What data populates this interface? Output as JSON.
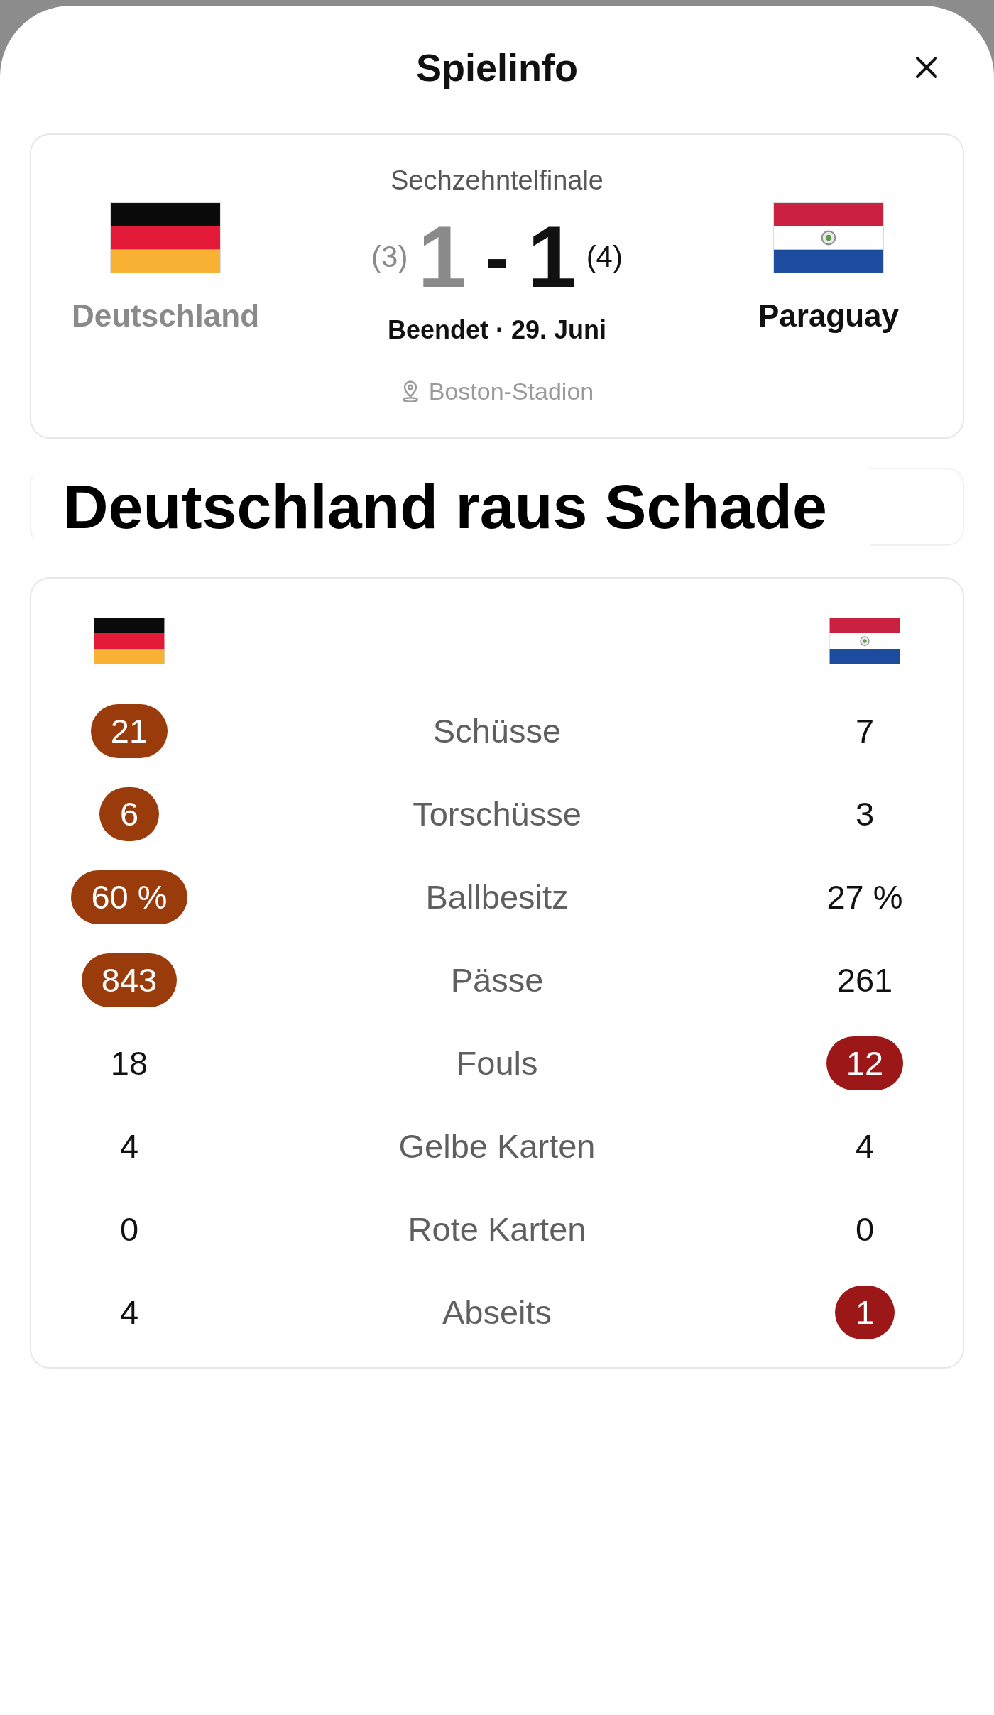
{
  "sheet": {
    "title": "Spielinfo"
  },
  "match": {
    "round": "Sechzehntelfinale",
    "teams": [
      {
        "name": "Deutschland",
        "goals": "1",
        "penalties": "(3)",
        "winner": false,
        "color": "#9a3b0b"
      },
      {
        "name": "Paraguay",
        "goals": "1",
        "penalties": "(4)",
        "winner": true,
        "color": "#9c1717"
      }
    ],
    "score_separator": "-",
    "status": "Beendet · 29. Juni",
    "venue": "Boston-Stadion"
  },
  "headline": "Deutschland raus Schade",
  "stats": {
    "rows": [
      {
        "label": "Schüsse",
        "home": {
          "value": "21",
          "highlighted": true
        },
        "away": {
          "value": "7",
          "highlighted": false
        }
      },
      {
        "label": "Torschüsse",
        "home": {
          "value": "6",
          "highlighted": true
        },
        "away": {
          "value": "3",
          "highlighted": false
        }
      },
      {
        "label": "Ballbesitz",
        "home": {
          "value": "60 %",
          "highlighted": true
        },
        "away": {
          "value": "27 %",
          "highlighted": false
        }
      },
      {
        "label": "Pässe",
        "home": {
          "value": "843",
          "highlighted": true
        },
        "away": {
          "value": "261",
          "highlighted": false
        }
      },
      {
        "label": "Fouls",
        "home": {
          "value": "18",
          "highlighted": false
        },
        "away": {
          "value": "12",
          "highlighted": true
        }
      },
      {
        "label": "Gelbe Karten",
        "home": {
          "value": "4",
          "highlighted": false
        },
        "away": {
          "value": "4",
          "highlighted": false
        }
      },
      {
        "label": "Rote Karten",
        "home": {
          "value": "0",
          "highlighted": false
        },
        "away": {
          "value": "0",
          "highlighted": false
        }
      },
      {
        "label": "Abseits",
        "home": {
          "value": "4",
          "highlighted": false
        },
        "away": {
          "value": "1",
          "highlighted": true
        }
      }
    ]
  }
}
